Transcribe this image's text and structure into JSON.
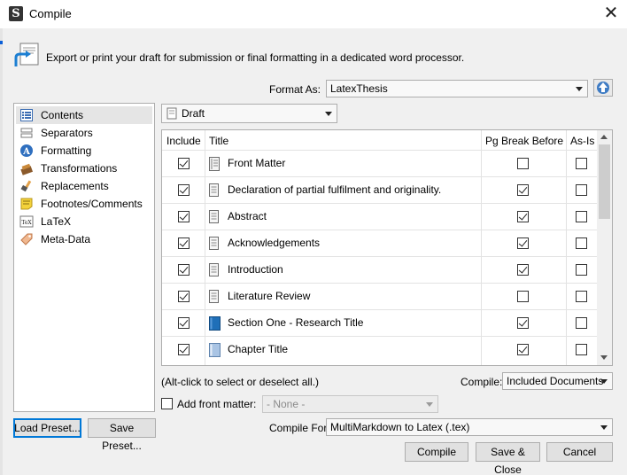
{
  "window": {
    "title": "Compile",
    "close_glyph": "✕",
    "app_icon_letter": "S"
  },
  "header": {
    "description": "Export or print your draft for submission or final formatting in a dedicated word processor."
  },
  "format_as": {
    "label": "Format As:",
    "value": "LatexThesis"
  },
  "sidebar": {
    "items": [
      {
        "label": "Contents",
        "icon": "contents-icon",
        "selected": true
      },
      {
        "label": "Separators",
        "icon": "separators-icon"
      },
      {
        "label": "Formatting",
        "icon": "formatting-icon"
      },
      {
        "label": "Transformations",
        "icon": "transformations-icon"
      },
      {
        "label": "Replacements",
        "icon": "replacements-icon"
      },
      {
        "label": "Footnotes/Comments",
        "icon": "footnotes-icon"
      },
      {
        "label": "LaTeX",
        "icon": "latex-icon"
      },
      {
        "label": "Meta-Data",
        "icon": "metadata-icon"
      }
    ]
  },
  "draft_select": {
    "value": "Draft"
  },
  "table": {
    "headers": {
      "include": "Include",
      "title": "Title",
      "pg_break": "Pg Break Before",
      "as_is": "As-Is"
    },
    "rows": [
      {
        "include": true,
        "title": "Front Matter",
        "icon": "front-matter-folder-icon",
        "pg_break": false,
        "as_is": false
      },
      {
        "include": true,
        "title": "Declaration of partial fulfilment and originality.",
        "icon": "document-icon",
        "pg_break": true,
        "as_is": false
      },
      {
        "include": true,
        "title": "Abstract",
        "icon": "document-icon",
        "pg_break": true,
        "as_is": false
      },
      {
        "include": true,
        "title": "Acknowledgements",
        "icon": "document-icon",
        "pg_break": true,
        "as_is": false
      },
      {
        "include": true,
        "title": "Introduction",
        "icon": "document-icon",
        "pg_break": true,
        "as_is": false
      },
      {
        "include": true,
        "title": "Literature Review",
        "icon": "document-icon",
        "pg_break": false,
        "as_is": false
      },
      {
        "include": true,
        "title": "Section One - Research Title",
        "icon": "blue-book-icon",
        "pg_break": true,
        "as_is": false
      },
      {
        "include": true,
        "title": "Chapter Title",
        "icon": "folder-icon",
        "pg_break": true,
        "as_is": false
      }
    ]
  },
  "hint": "(Alt-click to select or deselect all.)",
  "compile_scope": {
    "label": "Compile:",
    "value": "Included Documents"
  },
  "front_matter": {
    "label": "Add front matter:",
    "value": "- None -",
    "checked": false
  },
  "compile_for": {
    "label": "Compile For:",
    "value": "MultiMarkdown to Latex (.tex)"
  },
  "buttons": {
    "load_preset": "Load Preset...",
    "save_preset": "Save Preset...",
    "compile": "Compile",
    "save_close": "Save & Close",
    "cancel": "Cancel"
  },
  "colors": {
    "accent": "#0078d7",
    "book_blue": "#1f6fb8",
    "footnote_yellow": "#f3d23a"
  }
}
